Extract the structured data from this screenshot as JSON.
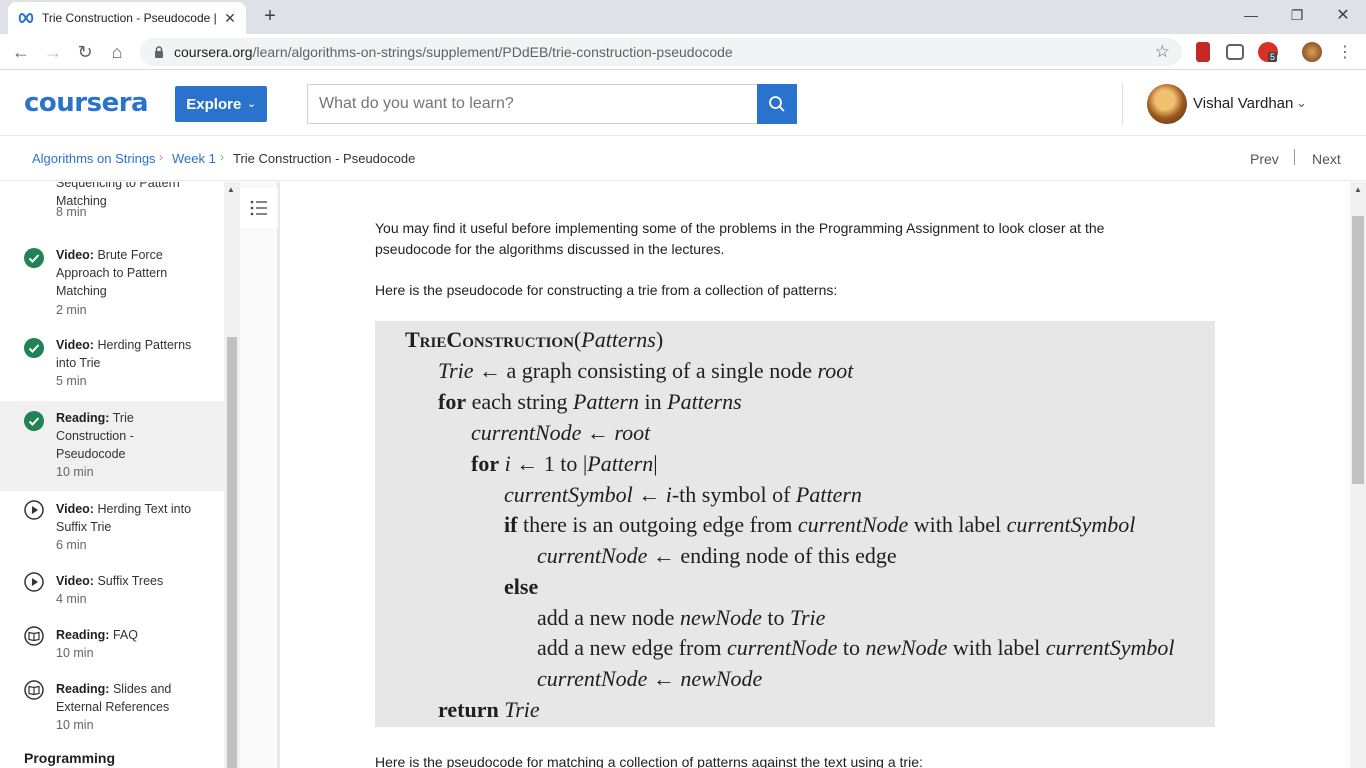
{
  "browser": {
    "tab_title": "Trie Construction - Pseudocode |",
    "url_host": "coursera.org",
    "url_path": "/learn/algorithms-on-strings/supplement/PDdEB/trie-construction-pseudocode",
    "ext_badge": "5"
  },
  "header": {
    "logo": "coursera",
    "explore_label": "Explore",
    "search_placeholder": "What do you want to learn?",
    "user_name": "Vishal Vardhan"
  },
  "breadcrumb": {
    "course": "Algorithms on Strings",
    "week": "Week 1",
    "current": "Trie Construction - Pseudocode",
    "prev": "Prev",
    "next": "Next"
  },
  "sidebar": {
    "items": [
      {
        "kind": "",
        "title": "Sequencing to Pattern Matching",
        "duration": "8 min",
        "status": "none"
      },
      {
        "kind": "Video:",
        "title": "Brute Force Approach to Pattern Matching",
        "duration": "2 min",
        "status": "done"
      },
      {
        "kind": "Video:",
        "title": "Herding Patterns into Trie",
        "duration": "5 min",
        "status": "done"
      },
      {
        "kind": "Reading:",
        "title": "Trie Construction - Pseudocode",
        "duration": "10 min",
        "status": "done"
      },
      {
        "kind": "Video:",
        "title": "Herding Text into Suffix Trie",
        "duration": "6 min",
        "status": "video"
      },
      {
        "kind": "Video:",
        "title": "Suffix Trees",
        "duration": "4 min",
        "status": "video"
      },
      {
        "kind": "Reading:",
        "title": "FAQ",
        "duration": "10 min",
        "status": "reading"
      },
      {
        "kind": "Reading:",
        "title": "Slides and External References",
        "duration": "10 min",
        "status": "reading"
      }
    ],
    "section_next": "Programming"
  },
  "content": {
    "intro": "You may find it useful before implementing some of the problems in the Programming Assignment to look closer at the pseudocode for the algorithms discussed in the lectures.",
    "lead": "Here is the pseudocode for constructing a trie from a collection of patterns:",
    "pseudocode": {
      "l1a": "TrieConstruction",
      "l1b": "(",
      "l1c": "Patterns",
      "l1d": ")",
      "l2a": "Trie",
      "l2b": " ← a graph consisting of a single node ",
      "l2c": "root",
      "l3a": "for",
      "l3b": " each string ",
      "l3c": "Pattern",
      "l3d": " in ",
      "l3e": "Patterns",
      "l4a": "currentNode",
      "l4b": " ← ",
      "l4c": "root",
      "l5a": "for",
      "l5b": " ",
      "l5c": "i",
      "l5d": " ← 1 to |",
      "l5e": "Pattern",
      "l5f": "|",
      "l6a": "currentSymbol",
      "l6b": " ← ",
      "l6c": "i",
      "l6d": "-th symbol of ",
      "l6e": "Pattern",
      "l7a": "if",
      "l7b": " there is an outgoing edge from ",
      "l7c": "currentNode",
      "l7d": " with label ",
      "l7e": "currentSymbol",
      "l8a": "currentNode",
      "l8b": " ← ending node of this edge",
      "l9a": "else",
      "l10a": "add a new node ",
      "l10b": "newNode",
      "l10c": " to ",
      "l10d": "Trie",
      "l11a": "add a new edge from ",
      "l11b": "currentNode",
      "l11c": " to ",
      "l11d": "newNode",
      "l11e": " with label ",
      "l11f": "currentSymbol",
      "l12a": "currentNode",
      "l12b": " ← ",
      "l12c": "newNode",
      "l13a": "return",
      "l13b": " ",
      "l13c": "Trie"
    },
    "next_lead": "Here is the pseudocode for matching a collection of patterns against the text using a trie:"
  },
  "colors": {
    "brand": "#2a73cc",
    "done_green": "#1f8354",
    "code_bg": "#e7e7e8"
  },
  "icons": {
    "tab_favicon": "coursera-infinity-icon",
    "done": "check-circle-icon",
    "video": "play-circle-icon",
    "reading": "book-icon",
    "toc": "list-icon",
    "search": "search-icon"
  }
}
